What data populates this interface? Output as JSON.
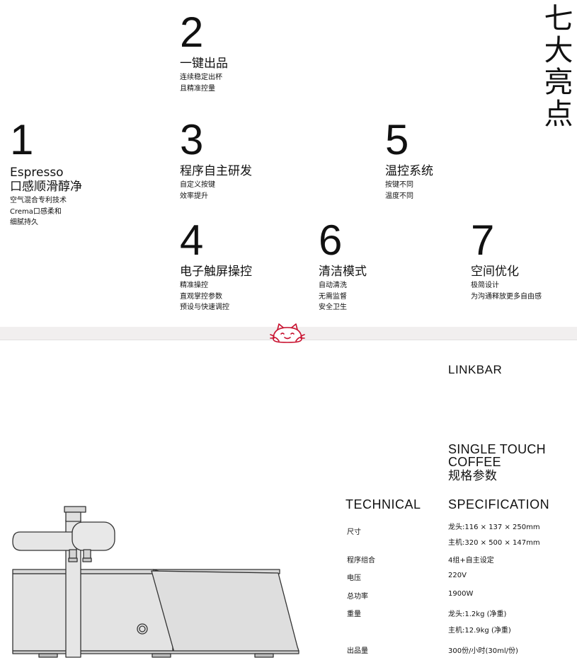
{
  "section_title": [
    "七",
    "大",
    "亮",
    "点"
  ],
  "features": [
    {
      "num": "1",
      "title_lines": [
        "Espresso",
        "口感顺滑醇净"
      ],
      "desc": [
        "空气混合专利技术",
        "Crema口感柔和",
        "细腻持久"
      ]
    },
    {
      "num": "2",
      "title_lines": [
        "一键出品"
      ],
      "desc": [
        "连续稳定出杯",
        "且精准控量"
      ]
    },
    {
      "num": "3",
      "title_lines": [
        "程序自主研发"
      ],
      "desc": [
        "自定义按键",
        "效率提升"
      ]
    },
    {
      "num": "4",
      "title_lines": [
        "电子触屏操控"
      ],
      "desc": [
        "精准操控",
        "直观掌控参数",
        "预设与快速调控"
      ]
    },
    {
      "num": "5",
      "title_lines": [
        "温控系统"
      ],
      "desc": [
        "按键不同",
        "温度不同"
      ]
    },
    {
      "num": "6",
      "title_lines": [
        "清洁模式"
      ],
      "desc": [
        "自动清洗",
        "无需监督",
        "安全卫生"
      ]
    },
    {
      "num": "7",
      "title_lines": [
        "空间优化"
      ],
      "desc": [
        "极简设计",
        "为沟通释放更多自由感"
      ]
    }
  ],
  "brand": "LINKBAR",
  "product": {
    "line1": "SINGLE TOUCH",
    "line2": "COFFEE",
    "line3": "规格参数"
  },
  "spec_headers": {
    "left": "TECHNICAL",
    "right": "SPECIFICATION"
  },
  "specs": [
    {
      "label": "尺寸",
      "values": [
        "龙头:116 × 137 × 250mm",
        "主机:320 × 500 × 147mm"
      ]
    },
    {
      "label": "程序组合",
      "values": [
        "4组+自主设定"
      ]
    },
    {
      "label": "电压",
      "values": [
        "220V"
      ]
    },
    {
      "label": "总功率",
      "values": [
        "1900W"
      ]
    },
    {
      "label": "重量",
      "values": [
        "龙头:1.2kg (净重)",
        "主机:12.9kg (净重)"
      ]
    },
    {
      "label": "出品量",
      "values": [
        "300份/小时(30ml/份)"
      ]
    }
  ],
  "colors": {
    "accent": "#c8102e",
    "divider": "#f1efef",
    "machine_fill": "#e3e3e3",
    "machine_stroke": "#333333"
  },
  "icons": {
    "mascot": "lucky-cat-icon"
  }
}
